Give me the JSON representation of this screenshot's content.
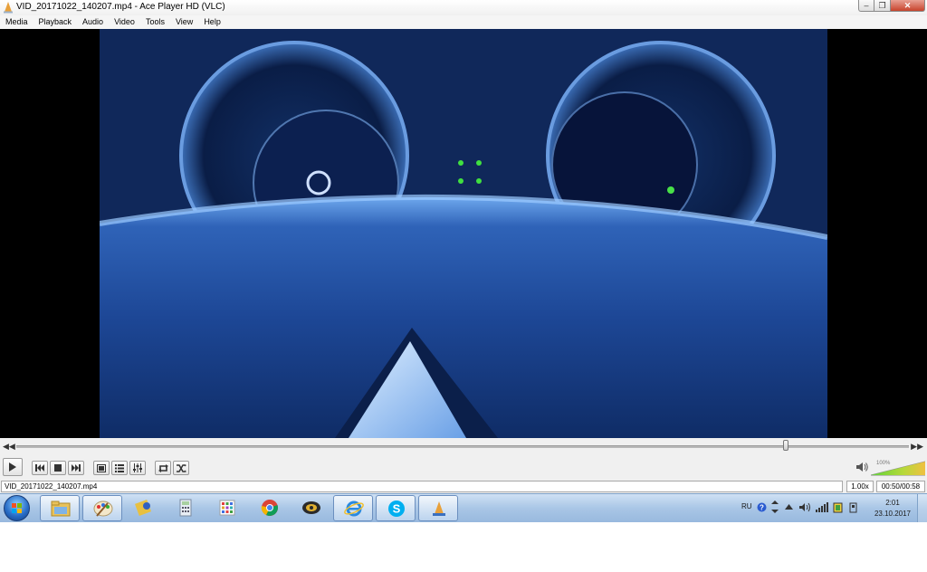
{
  "window": {
    "title": "VID_20171022_140207.mp4 - Ace Player HD (VLC)",
    "minimize": "–",
    "maximize": "❐",
    "close": "✕"
  },
  "menu": {
    "items": [
      "Media",
      "Playback",
      "Audio",
      "Video",
      "Tools",
      "View",
      "Help"
    ]
  },
  "player": {
    "seek_position": 0.862,
    "volume_label": "100%",
    "volume_level": 1.0
  },
  "status": {
    "filename": "VID_20171022_140207.mp4",
    "speed": "1.00x",
    "time": "00:50/00:58"
  },
  "taskbar": {
    "apps": [
      "explorer",
      "paint",
      "tool",
      "calculator",
      "apps-grid",
      "chrome",
      "ace-stream",
      "internet-explorer",
      "skype",
      "ace-player"
    ],
    "tray_language": "RU",
    "clock_time": "2:01",
    "clock_date": "23.10.2017"
  },
  "colors": {
    "accent": "#3a7bd5",
    "video_bg": "#000000",
    "volume_green": "#3fbf2f"
  }
}
